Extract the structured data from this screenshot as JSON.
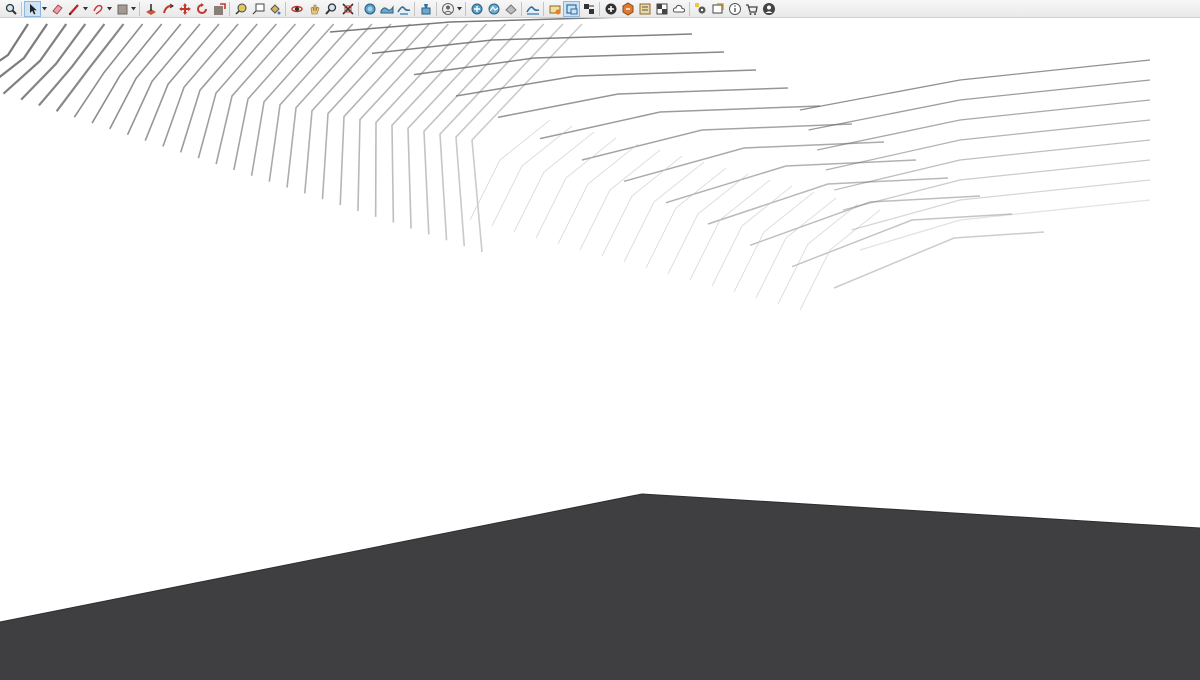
{
  "toolbar": {
    "tools": [
      {
        "icon": "zoom-window-icon"
      },
      {
        "icon": "select-arrow-icon",
        "active": true,
        "dropdown": true
      },
      {
        "icon": "eraser-icon"
      },
      {
        "icon": "pencil-line-icon",
        "dropdown": true
      },
      {
        "icon": "freehand-shape-icon",
        "dropdown": true
      },
      {
        "icon": "rectangle-shape-icon",
        "dropdown": true
      },
      {
        "icon": "push-pull-icon"
      },
      {
        "icon": "follow-me-icon"
      },
      {
        "icon": "move-icon"
      },
      {
        "icon": "rotate-icon"
      },
      {
        "icon": "scale-icon"
      },
      {
        "icon": "tape-measure-icon"
      },
      {
        "icon": "text-label-icon"
      },
      {
        "icon": "paint-bucket-icon"
      },
      {
        "icon": "orbit-icon"
      },
      {
        "icon": "pan-icon"
      },
      {
        "icon": "zoom-icon"
      },
      {
        "icon": "zoom-extents-icon"
      },
      {
        "icon": "sandbox-from-contours-icon"
      },
      {
        "icon": "sandbox-from-scratch-icon"
      },
      {
        "icon": "smoove-icon"
      },
      {
        "icon": "stamp-icon"
      },
      {
        "icon": "user-account-icon",
        "dropdown": true
      },
      {
        "icon": "add-location-icon"
      },
      {
        "icon": "terrain-toggle-icon"
      },
      {
        "icon": "photo-texture-icon"
      },
      {
        "icon": "drape-icon"
      },
      {
        "icon": "section-plane-icon"
      },
      {
        "icon": "display-section-cuts-icon",
        "active": true
      },
      {
        "icon": "section-fill-icon"
      },
      {
        "icon": "3d-warehouse-icon"
      },
      {
        "icon": "share-model-icon"
      },
      {
        "icon": "model-info-icon"
      },
      {
        "icon": "styles-checker-icon"
      },
      {
        "icon": "cloud-icon"
      },
      {
        "icon": "extension-manager-icon"
      },
      {
        "icon": "layout-send-icon"
      },
      {
        "icon": "info-icon"
      },
      {
        "icon": "extension-warehouse-cart-icon"
      },
      {
        "icon": "profile-icon"
      }
    ],
    "separator_after": [
      0,
      5,
      10,
      13,
      17,
      20,
      21,
      22,
      25,
      26,
      29,
      34
    ]
  },
  "scene": {
    "background": "#ffffff",
    "ground_color": "#3f3e41",
    "contour_color": "#6c6c6c",
    "faint_contour_color": "#c9bfd0"
  }
}
